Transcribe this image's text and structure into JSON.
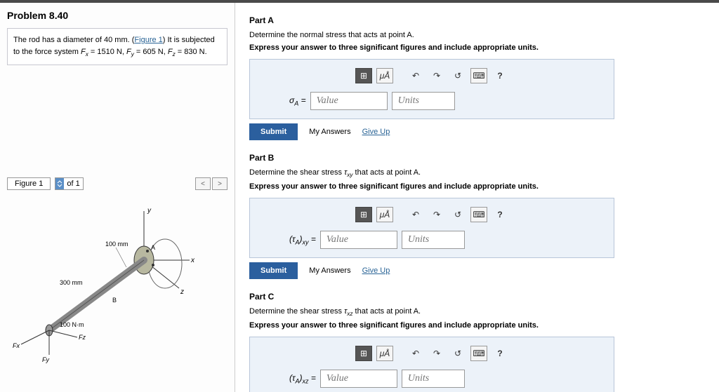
{
  "problem": {
    "title": "Problem 8.40",
    "text_a": "The rod has a diameter of 40 mm. (",
    "figure_link": "Figure 1",
    "text_b": ") It is subjected to the force system ",
    "fx_eq": "F",
    "fx_sub": "x",
    "fx_val": " = 1510 N, ",
    "fy_eq": "F",
    "fy_sub": "y",
    "fy_val": " = 605 N, ",
    "fz_eq": "F",
    "fz_sub": "z",
    "fz_val": " = 830 N."
  },
  "figure_controls": {
    "label": "Figure 1",
    "of": "of 1",
    "prev": "<",
    "next": ">"
  },
  "figure_labels": {
    "y": "y",
    "x": "x",
    "z": "z",
    "r100": "100 mm",
    "r300": "300 mm",
    "A": "A",
    "B": "B",
    "torque": "100 N·m",
    "Fx": "Fx",
    "Fy": "Fy",
    "Fz": "Fz"
  },
  "parts": {
    "a": {
      "title": "Part A",
      "desc": "Determine the normal stress that acts at point A.",
      "instr": "Express your answer to three significant figures and include appropriate units.",
      "eq_sym": "σ",
      "eq_sub": "A",
      "eq_after": " = "
    },
    "b": {
      "title": "Part B",
      "desc_a": "Determine the shear stress ",
      "desc_sym": "τ",
      "desc_sub": "xy",
      "desc_b": " that acts at point A.",
      "instr": "Express your answer to three significant figures and include appropriate units.",
      "eq_pre": "(",
      "eq_sym": "τ",
      "eq_sub1": "A",
      "eq_post": ")",
      "eq_sub2": "xy",
      "eq_after": " = "
    },
    "c": {
      "title": "Part C",
      "desc_a": "Determine the shear stress ",
      "desc_sym": "τ",
      "desc_sub": "xz",
      "desc_b": " that acts at point A.",
      "instr": "Express your answer to three significant figures and include appropriate units.",
      "eq_pre": "(",
      "eq_sym": "τ",
      "eq_sub1": "A",
      "eq_post": ")",
      "eq_sub2": "xz",
      "eq_after": " = "
    }
  },
  "inputs": {
    "value_ph": "Value",
    "units_ph": "Units"
  },
  "toolbar_btns": {
    "template": "⊞",
    "symbol": "μÅ",
    "undo": "↶",
    "redo": "↷",
    "reset": "↺",
    "keyboard": "⌨",
    "help": "?"
  },
  "actions": {
    "submit": "Submit",
    "my_answers": "My Answers",
    "give_up": "Give Up"
  }
}
